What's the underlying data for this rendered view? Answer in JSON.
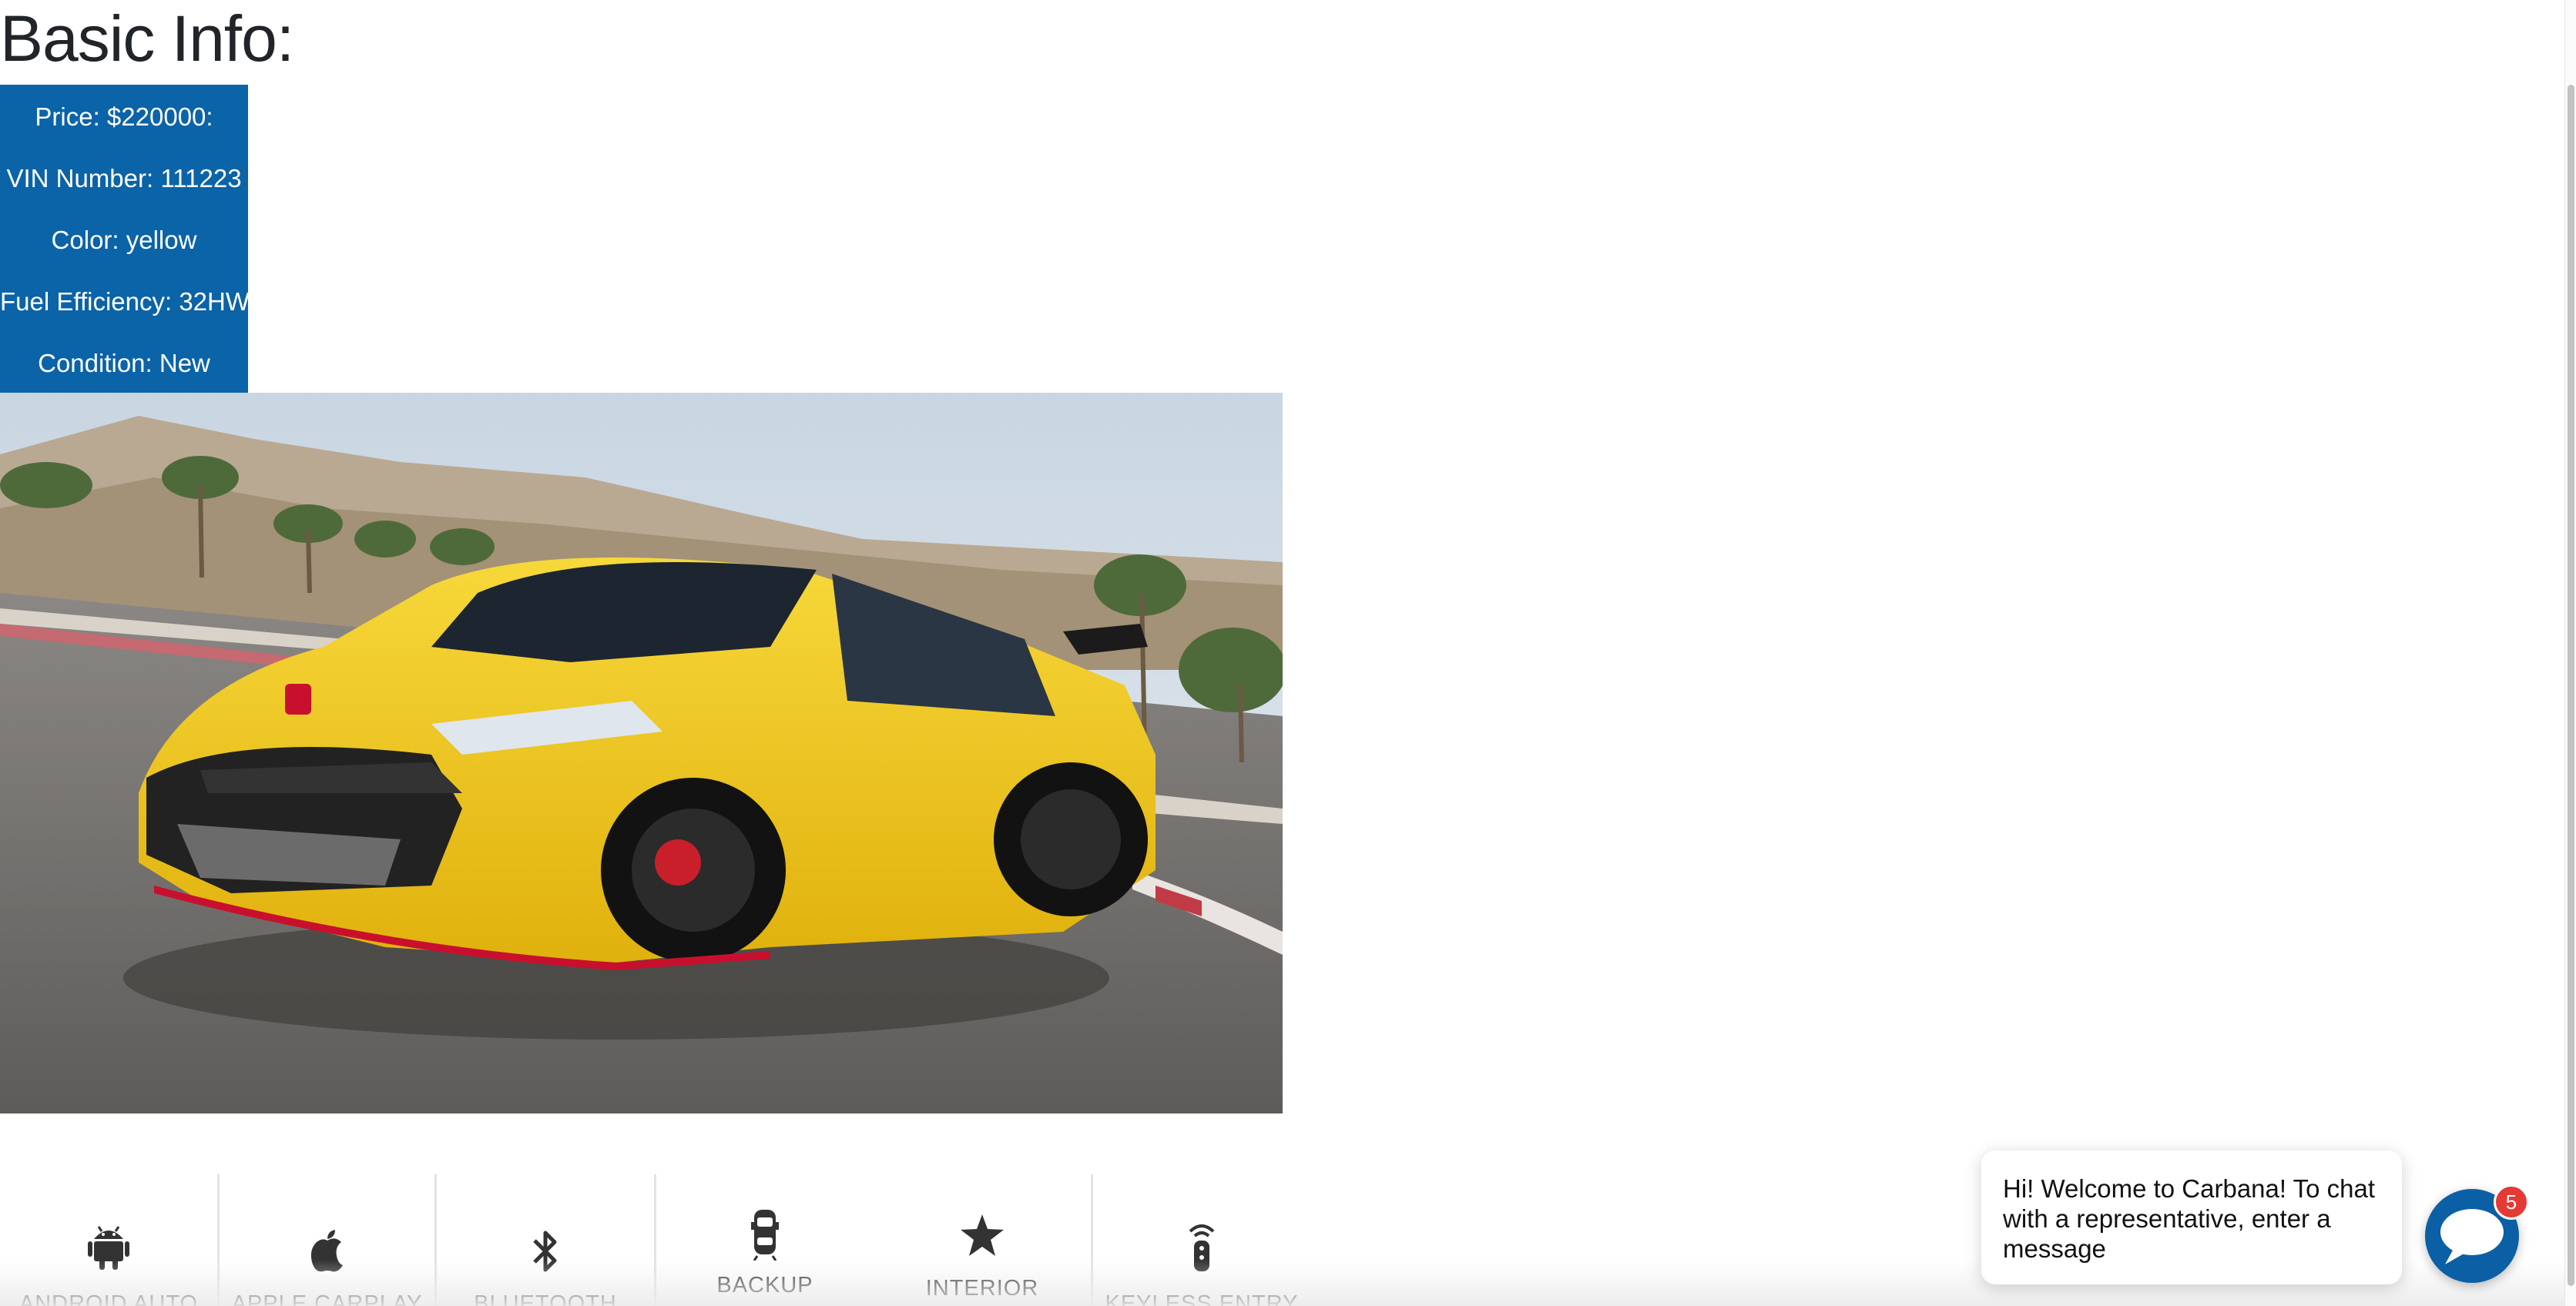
{
  "page": {
    "title": "Basic Info:"
  },
  "basic_info": {
    "price": "Price: $220000:",
    "vin": "VIN Number: 111223",
    "color": "Color: yellow",
    "fuel_efficiency": "Fuel Efficiency: 32HW",
    "condition": "Condition: New"
  },
  "features": [
    {
      "label": "ANDROID AUTO",
      "icon": "android-icon"
    },
    {
      "label": "APPLE CARPLAY",
      "icon": "apple-icon"
    },
    {
      "label": "BLUETOOTH",
      "icon": "bluetooth-icon"
    },
    {
      "label": "BACKUP",
      "icon": "car-backup-icon"
    },
    {
      "label": "INTERIOR",
      "icon": "star-icon"
    },
    {
      "label": "KEYLESS ENTRY",
      "icon": "key-fob-icon"
    }
  ],
  "chat": {
    "message": "Hi! Welcome to Carbana! To chat with a representative, enter a message",
    "badge_count": "5",
    "icon": "chat-bubble-icon"
  },
  "colors": {
    "info_box": "#0b63a8",
    "chat_launcher": "#0b5fa5",
    "badge": "#e53935",
    "car": "#f2c417"
  }
}
